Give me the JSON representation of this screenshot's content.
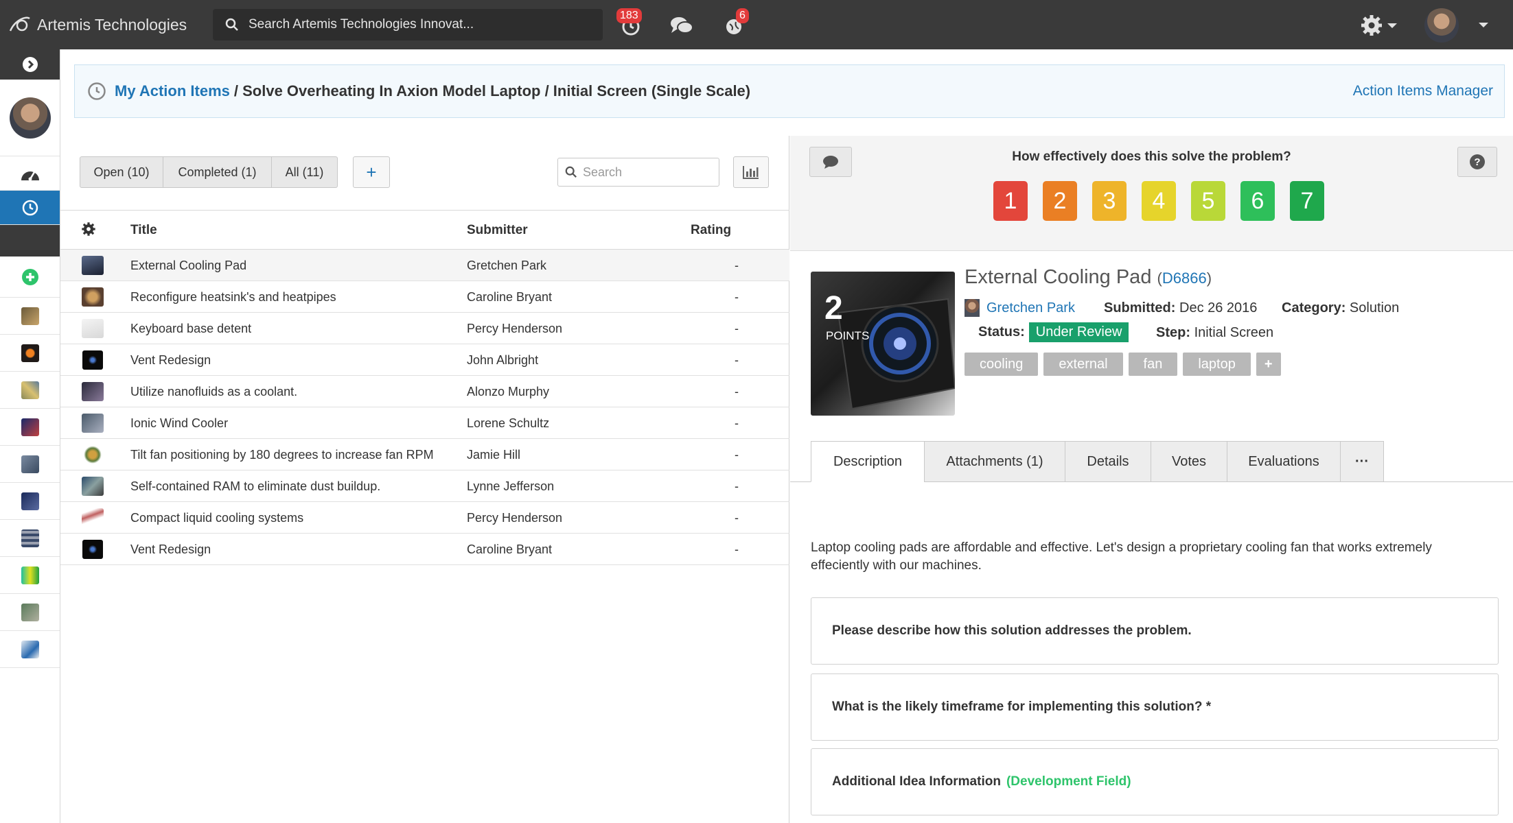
{
  "app": {
    "brand": "Artemis Technologies"
  },
  "topbar": {
    "search_placeholder": "Search Artemis Technologies Innovat...",
    "notifications_badge": "183",
    "alerts_badge": "6"
  },
  "breadcrumb": {
    "link": "My Action Items",
    "rest": "/ Solve Overheating In Axion Model Laptop / Initial Screen (Single Scale)",
    "manager_link": "Action Items Manager"
  },
  "filters": {
    "open": "Open (10)",
    "completed": "Completed (1)",
    "all": "All (11)",
    "add": "+",
    "search_placeholder": "Search"
  },
  "table": {
    "headers": {
      "title": "Title",
      "submitter": "Submitter",
      "rating": "Rating"
    },
    "rows": [
      {
        "title": "External Cooling Pad",
        "submitter": "Gretchen Park",
        "rating": "-"
      },
      {
        "title": "Reconfigure heatsink's and heatpipes",
        "submitter": "Caroline Bryant",
        "rating": "-"
      },
      {
        "title": "Keyboard base detent",
        "submitter": "Percy Henderson",
        "rating": "-"
      },
      {
        "title": "Vent Redesign",
        "submitter": "John Albright",
        "rating": "-"
      },
      {
        "title": "Utilize nanofluids as a coolant.",
        "submitter": "Alonzo Murphy",
        "rating": "-"
      },
      {
        "title": "Ionic Wind Cooler",
        "submitter": "Lorene Schultz",
        "rating": "-"
      },
      {
        "title": "Tilt fan positioning by 180 degrees to increase fan RPM",
        "submitter": "Jamie Hill",
        "rating": "-"
      },
      {
        "title": "Self-contained RAM to eliminate dust buildup.",
        "submitter": "Lynne Jefferson",
        "rating": "-"
      },
      {
        "title": "Compact liquid cooling systems",
        "submitter": "Percy Henderson",
        "rating": "-"
      },
      {
        "title": "Vent Redesign",
        "submitter": "Caroline Bryant",
        "rating": "-"
      }
    ]
  },
  "rating": {
    "question": "How effectively does this solve the problem?",
    "scores": [
      {
        "label": "1",
        "color": "#e3463b"
      },
      {
        "label": "2",
        "color": "#ea7f24"
      },
      {
        "label": "3",
        "color": "#eeb42a"
      },
      {
        "label": "4",
        "color": "#e6d42b"
      },
      {
        "label": "5",
        "color": "#b9d838"
      },
      {
        "label": "6",
        "color": "#2ebf5a"
      },
      {
        "label": "7",
        "color": "#1fa84c"
      }
    ]
  },
  "item": {
    "points": "2",
    "points_label": "POINTS",
    "title": "External Cooling Pad",
    "id_open": "(",
    "id": "D6866",
    "id_close": ")",
    "submitter": "Gretchen Park",
    "submitted_label": "Submitted:",
    "submitted": "Dec 26 2016",
    "category_label": "Category:",
    "category": "Solution",
    "status_label": "Status:",
    "status": "Under Review",
    "step_label": "Step:",
    "step": "Initial Screen",
    "tags": [
      "cooling",
      "external",
      "fan",
      "laptop"
    ],
    "tag_add": "+"
  },
  "tabs": [
    "Description",
    "Attachments (1)",
    "Details",
    "Votes",
    "Evaluations",
    "···"
  ],
  "description": "Laptop cooling pads are affordable and effective. Let's design a proprietary cooling fan that works extremely effeciently with our machines.",
  "cards": {
    "q1": "Please describe how this solution addresses the problem.",
    "q2": "What is the likely timeframe for implementing this solution? *",
    "q3": "Additional Idea Information",
    "q3_tag": "(Development Field)"
  },
  "colors": {
    "accent": "#1f75b5",
    "topbar": "#3a3a3a",
    "status": "#19a06b",
    "badge": "#e23b3b"
  }
}
